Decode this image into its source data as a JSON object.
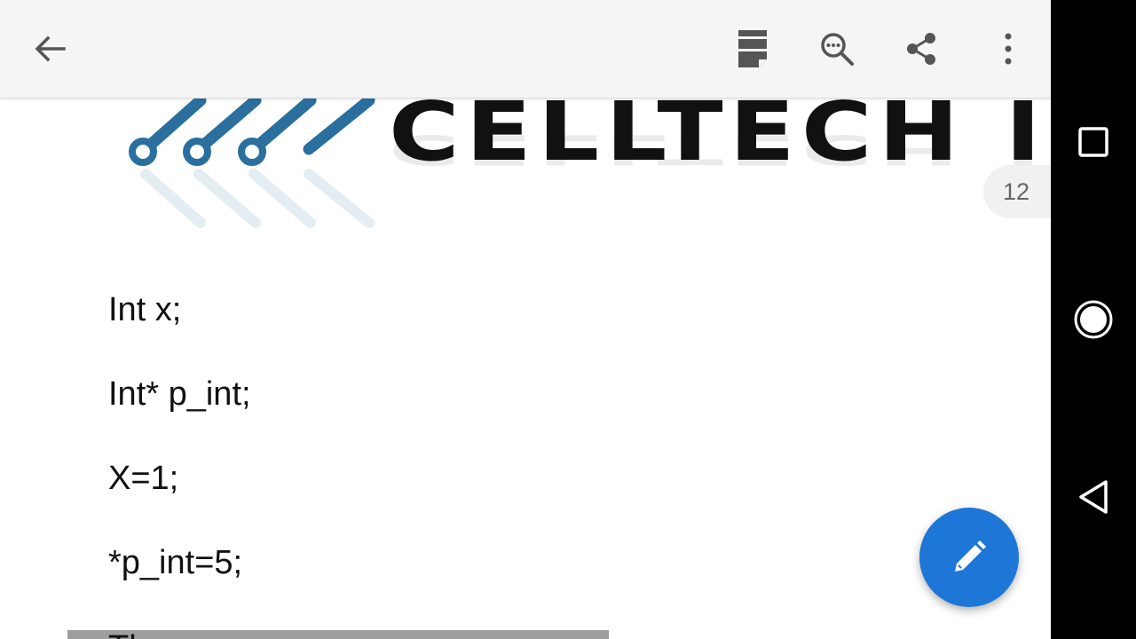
{
  "toolbar": {
    "icons": [
      "arrow-back-icon",
      "outline-icon",
      "find-in-page-icon",
      "share-icon",
      "more-vert-icon"
    ]
  },
  "document": {
    "logo_text": "CELLTECH IN",
    "page_number": "12",
    "code_lines": [
      "Int x;",
      "Int* p_int;",
      "X=1;",
      "*p_int=5;"
    ],
    "partial_line": "Th"
  },
  "fab": {
    "icon": "pencil-icon"
  },
  "navbar": {
    "icons": [
      "recents-square-icon",
      "home-circle-icon",
      "back-triangle-icon"
    ]
  },
  "colors": {
    "toolbar_bg": "#f5f5f5",
    "fab_bg": "#1e76d6",
    "logo_accent": "#2a6f9e",
    "navbar_bg": "#000000"
  }
}
